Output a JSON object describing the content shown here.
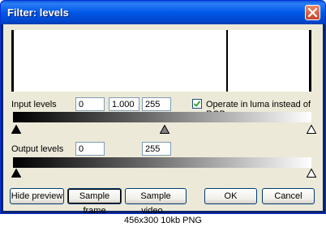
{
  "window": {
    "title": "Filter: levels"
  },
  "histogram": {
    "bars": [
      0.0,
      0.715,
      1.0
    ]
  },
  "input": {
    "label": "Input levels",
    "low": "0",
    "gamma": "1.000",
    "high": "255",
    "handles": [
      0.0,
      0.5,
      1.0
    ]
  },
  "luma": {
    "label": "Operate in luma instead of RGB",
    "checked": true
  },
  "output": {
    "label": "Output levels",
    "low": "0",
    "high": "255",
    "handles": [
      0.0,
      1.0
    ]
  },
  "buttons": {
    "hide_preview": "Hide preview",
    "sample_frame": "Sample frame",
    "sample_video": "Sample video...",
    "ok": "OK",
    "cancel": "Cancel"
  },
  "caption": "456x300  10kb  PNG"
}
